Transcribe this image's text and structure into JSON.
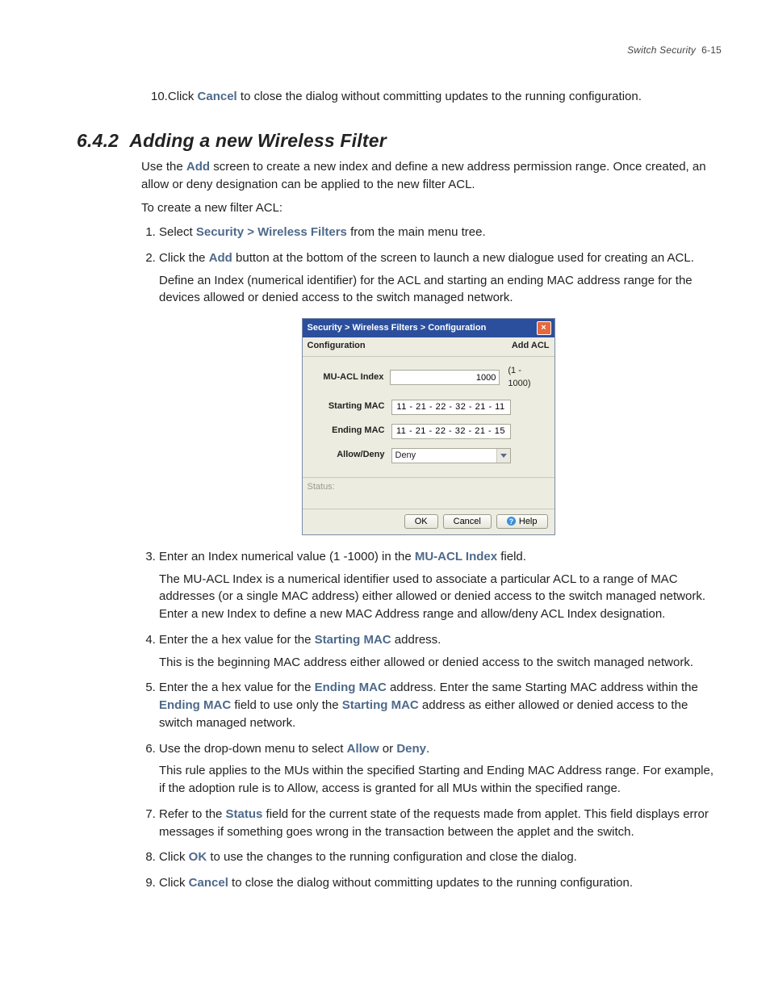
{
  "header": {
    "title": "Switch Security",
    "page": "6-15"
  },
  "prior": {
    "num": "10.",
    "pre": "Click ",
    "bold": "Cancel",
    "post": " to close the dialog without committing updates to the running configuration."
  },
  "section": {
    "num": "6.4.2",
    "title": "Adding a new Wireless Filter"
  },
  "intro": {
    "pre": "Use the ",
    "bold": "Add",
    "post": " screen to create a new index and define a new address permission range. Once created, an allow or deny designation can be applied to the new filter ACL."
  },
  "intro2": "To create a new filter ACL:",
  "steps": [
    {
      "parts": [
        {
          "t": "Select "
        },
        {
          "t": "Security > Wireless Filters",
          "b": true
        },
        {
          "t": " from the main menu tree."
        }
      ]
    },
    {
      "parts": [
        {
          "t": "Click the "
        },
        {
          "t": "Add",
          "b": true
        },
        {
          "t": " button at the bottom of the screen to launch a new dialogue used for creating an ACL."
        }
      ],
      "sub": [
        {
          "parts": [
            {
              "t": "Define an Index (numerical identifier) for the ACL and starting an ending MAC address range for the devices allowed or denied access to the switch managed network."
            }
          ]
        }
      ],
      "dialog": true
    },
    {
      "parts": [
        {
          "t": "Enter an Index numerical value (1 -1000) in the "
        },
        {
          "t": "MU-ACL Index",
          "b": true
        },
        {
          "t": " field."
        }
      ],
      "sub": [
        {
          "parts": [
            {
              "t": "The MU-ACL Index is a numerical identifier used to associate a particular ACL to a range of MAC addresses (or a single MAC address) either allowed or denied access to the switch managed network. Enter a new Index to define a new MAC Address range and allow/deny ACL Index designation."
            }
          ]
        }
      ]
    },
    {
      "parts": [
        {
          "t": "Enter the a hex value for the "
        },
        {
          "t": "Starting MAC",
          "b": true
        },
        {
          "t": " address."
        }
      ],
      "sub": [
        {
          "parts": [
            {
              "t": "This is the beginning MAC address either allowed or denied access to the switch managed network."
            }
          ]
        }
      ]
    },
    {
      "parts": [
        {
          "t": "Enter the a hex value for the "
        },
        {
          "t": "Ending MAC",
          "b": true
        },
        {
          "t": " address. Enter the same Starting MAC address within the "
        },
        {
          "t": "Ending MAC",
          "b": true
        },
        {
          "t": " field to use only the "
        },
        {
          "t": "Starting MAC",
          "b": true
        },
        {
          "t": " address as either allowed or denied access to the switch managed network."
        }
      ]
    },
    {
      "parts": [
        {
          "t": "Use the drop-down menu to select "
        },
        {
          "t": "Allow",
          "b": true
        },
        {
          "t": " or "
        },
        {
          "t": "Deny",
          "b": true
        },
        {
          "t": "."
        }
      ],
      "sub": [
        {
          "parts": [
            {
              "t": "This rule applies to the MUs within the specified Starting and Ending MAC Address range. For example, if the adoption rule is to Allow, access is granted for all MUs within the specified range."
            }
          ]
        }
      ]
    },
    {
      "parts": [
        {
          "t": "Refer to the "
        },
        {
          "t": "Status",
          "b": true
        },
        {
          "t": " field for the current state of the requests made from applet. This field displays error messages if something goes wrong in the transaction between the applet and the switch."
        }
      ]
    },
    {
      "parts": [
        {
          "t": "Click "
        },
        {
          "t": "OK",
          "b": true
        },
        {
          "t": " to use the changes to the running configuration and close the dialog."
        }
      ]
    },
    {
      "parts": [
        {
          "t": "Click "
        },
        {
          "t": "Cancel",
          "b": true
        },
        {
          "t": " to close the dialog without committing updates to the running configuration."
        }
      ]
    }
  ],
  "dialog": {
    "title": "Security > Wireless Filters > Configuration",
    "close": "×",
    "subLeft": "Configuration",
    "subRight": "Add ACL",
    "rows": {
      "indexLabel": "MU-ACL Index",
      "indexValue": "1000",
      "indexHint": "(1 - 1000)",
      "startLabel": "Starting MAC",
      "startValue": "11 - 21 - 22 - 32 - 21 - 11",
      "endLabel": "Ending MAC",
      "endValue": "11 - 21 - 22 - 32 - 21 - 15",
      "adLabel": "Allow/Deny",
      "adValue": "Deny"
    },
    "statusLabel": "Status:",
    "buttons": {
      "ok": "OK",
      "cancel": "Cancel",
      "help": "Help"
    }
  }
}
